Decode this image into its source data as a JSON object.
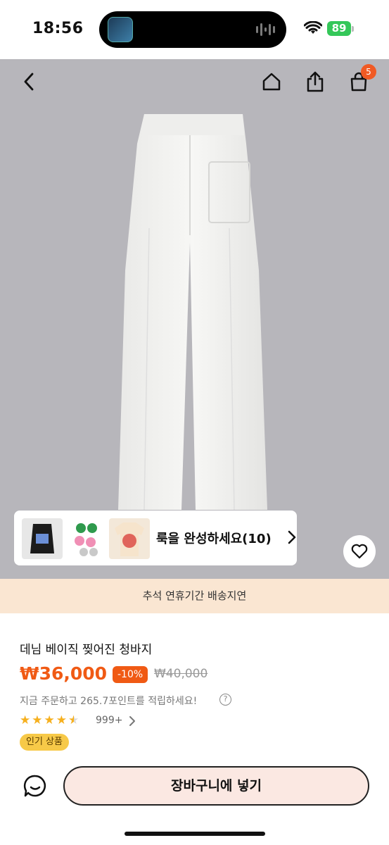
{
  "status_bar": {
    "time": "18:56",
    "battery": "89"
  },
  "header": {
    "cart_count": "5"
  },
  "look_card": {
    "label": "룩을 완성하세요(10)"
  },
  "notice": {
    "text": "추석 연휴기간 배송지연"
  },
  "product": {
    "title": "데님 베이직 찢어진 청바지",
    "price": "₩36,000",
    "discount": "-10%",
    "original_price": "₩40,000",
    "points_text": "지금 주문하고 265.7포인트를 적립하세요!",
    "rating": 4.5,
    "review_count": "999+",
    "badge": "인기 상품"
  },
  "actions": {
    "add_to_cart": "장바구니에 넣기"
  },
  "colors": {
    "accent": "#f05a14",
    "badge": "#f7c948",
    "notice_bg": "#fae6d2",
    "cart_btn_bg": "#fbe8e2"
  },
  "icons": [
    "back-icon",
    "home-icon",
    "share-icon",
    "shopping-bag-icon",
    "heart-icon",
    "chevron-right-icon",
    "chat-icon",
    "help-icon",
    "star-icon"
  ]
}
